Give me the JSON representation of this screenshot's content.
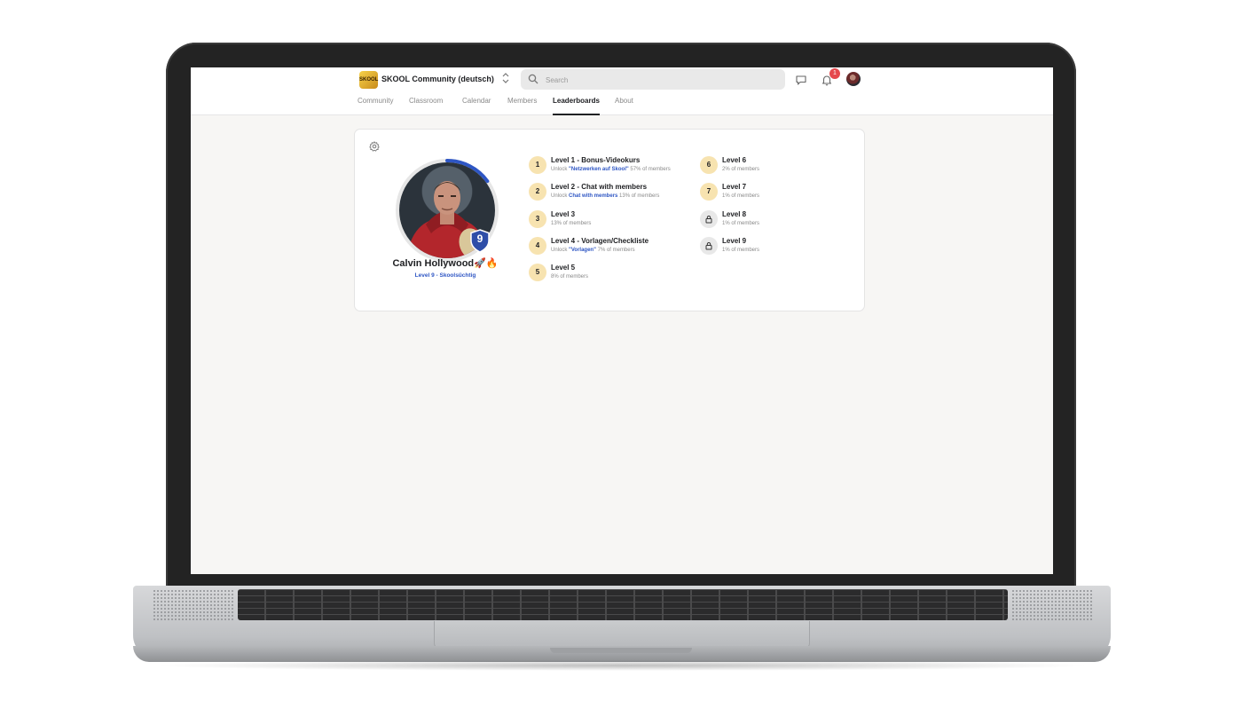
{
  "app": {
    "community_name": "SKOOL Community (deutsch)",
    "logo_text": "SKOOL",
    "switcher_icon": "chevron-updown-icon"
  },
  "search": {
    "placeholder": "Search"
  },
  "notifications": {
    "count": "1"
  },
  "tabs": [
    {
      "label": "Community"
    },
    {
      "label": "Classroom"
    },
    {
      "label": "Calendar"
    },
    {
      "label": "Members"
    },
    {
      "label": "Leaderboards",
      "active": true
    },
    {
      "label": "About"
    }
  ],
  "profile": {
    "name": "Calvin Hollywood",
    "emoji": "🚀🔥",
    "level_badge": "9",
    "level_text": "Level 9 - Skoolsüchtig",
    "progress_fraction": 0.15
  },
  "levels_left": [
    {
      "num": "1",
      "title": "Level 1 - Bonus-Videokurs",
      "prefix": "Unlock ",
      "link": "\"Netzwerken auf Skool\"",
      "pct": " 57% of members"
    },
    {
      "num": "2",
      "title": "Level 2 - Chat with members",
      "prefix": "Unlock ",
      "link": "Chat with members",
      "pct": " 13% of members"
    },
    {
      "num": "3",
      "title": "Level 3",
      "prefix": "",
      "link": "",
      "pct": "13% of members"
    },
    {
      "num": "4",
      "title": "Level 4 - Vorlagen/Checkliste",
      "prefix": "Unlock ",
      "link": "\"Vorlagen\"",
      "pct": " 7% of members"
    },
    {
      "num": "5",
      "title": "Level 5",
      "prefix": "",
      "link": "",
      "pct": "8% of members"
    }
  ],
  "levels_right": [
    {
      "num": "6",
      "title": "Level 6",
      "pct": "2% of members",
      "locked": false
    },
    {
      "num": "7",
      "title": "Level 7",
      "pct": "1% of members",
      "locked": false
    },
    {
      "num": "",
      "title": "Level 8",
      "pct": "1% of members",
      "locked": true
    },
    {
      "num": "",
      "title": "Level 9",
      "pct": "1% of members",
      "locked": true
    }
  ],
  "colors": {
    "accent_blue": "#2e56c4",
    "level_circle": "#f7e3b0",
    "badge_red": "#e5484d",
    "page_bg": "#f7f6f4"
  }
}
